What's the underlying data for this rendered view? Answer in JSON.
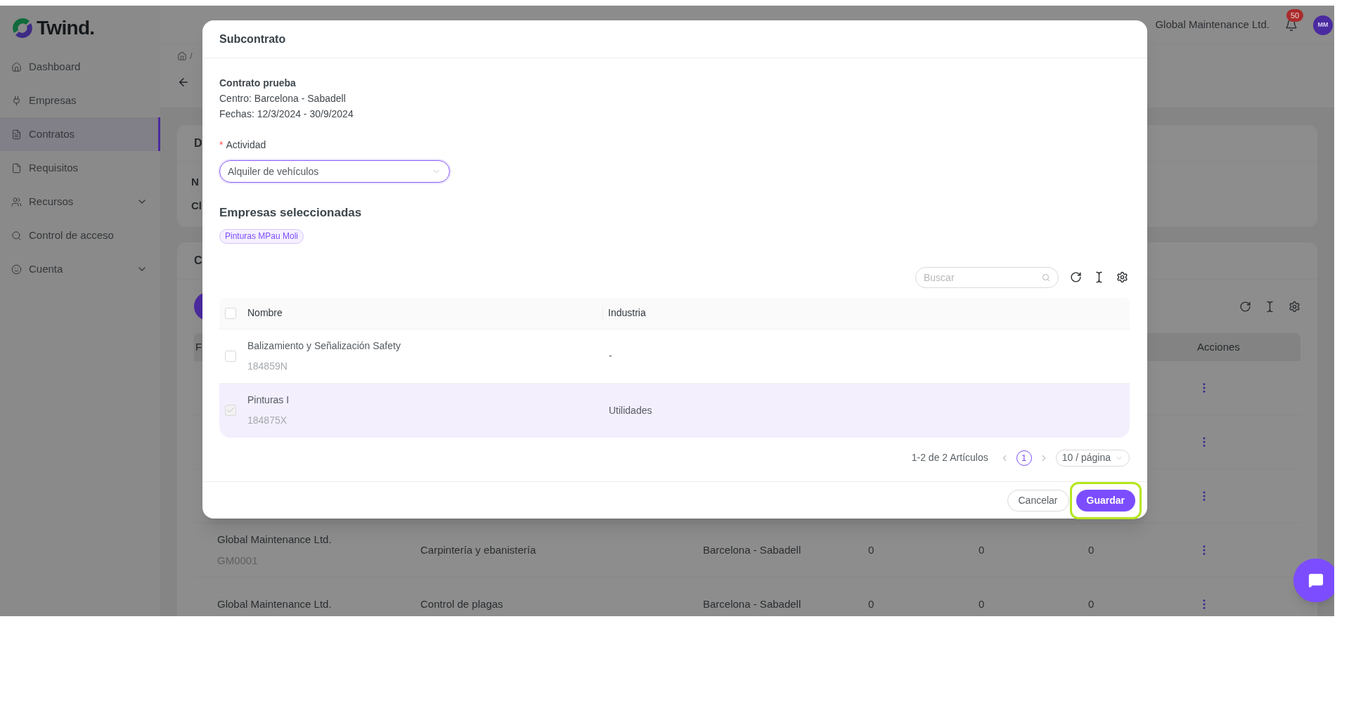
{
  "app": {
    "logo_text": "Twind."
  },
  "sidebar": {
    "items": [
      {
        "label": "Dashboard",
        "selected": false,
        "expandable": false
      },
      {
        "label": "Empresas",
        "selected": false,
        "expandable": false
      },
      {
        "label": "Contratos",
        "selected": true,
        "expandable": false
      },
      {
        "label": "Requisitos",
        "selected": false,
        "expandable": false
      },
      {
        "label": "Recursos",
        "selected": false,
        "expandable": true
      },
      {
        "label": "Control de acceso",
        "selected": false,
        "expandable": false
      },
      {
        "label": "Cuenta",
        "selected": false,
        "expandable": true
      }
    ]
  },
  "header": {
    "company": "Global Maintenance Ltd.",
    "notifications_badge": "50",
    "avatar_initials": "MM"
  },
  "breadcrumb": {
    "separator": "/"
  },
  "background": {
    "details_card": {
      "title": "D",
      "fields": [
        "N",
        "Cl"
      ]
    },
    "list_card": {
      "title": "C",
      "table": {
        "column_1": "F",
        "actions_header": "Acciones",
        "rows": [
          {
            "company": "Global Maintenance Ltd.",
            "code": "GM0001",
            "activity": "Carpintería y ebanistería",
            "center": "Barcelona - Sabadell",
            "column_4": "0",
            "column_5": "0",
            "column_6": "0"
          },
          {
            "company": "Global Maintenance Ltd.",
            "activity": "Control de plagas",
            "center": "Barcelona - Sabadell",
            "column_4": "0",
            "column_5": "0",
            "column_6": "0"
          }
        ]
      }
    }
  },
  "modal": {
    "title": "Subcontrato",
    "contract": {
      "name": "Contrato prueba",
      "center": "Centro: Barcelona - Sabadell",
      "dates": "Fechas: 12/3/2024 - 30/9/2024"
    },
    "activity_field": {
      "label": "Actividad",
      "required_mark": "*",
      "value": "Alquiler de vehículos",
      "focused": true
    },
    "selected_heading": "Empresas seleccionadas",
    "selected_tags": [
      "Pinturas MPau Moli"
    ],
    "search": {
      "placeholder": "Buscar"
    },
    "table": {
      "columns": [
        "Nombre",
        "Industria"
      ],
      "all_checked": false,
      "rows": [
        {
          "name": "Balizamiento y Señalización Safety",
          "code": "184859N",
          "industry": "-",
          "checked": false,
          "disabled": false
        },
        {
          "name": "Pinturas I",
          "code": "184875X",
          "industry": "Utilidades",
          "checked": true,
          "disabled": true
        }
      ]
    },
    "pagination": {
      "summary": "1-2 de 2 Artículos",
      "pages": [
        {
          "label": "1",
          "selected": true
        }
      ],
      "page_size": "10 / página"
    },
    "buttons": [
      {
        "label": "Cancelar",
        "kind": "secondary",
        "highlighted": false
      },
      {
        "label": "Guardar",
        "kind": "primary",
        "highlighted": true
      }
    ]
  }
}
